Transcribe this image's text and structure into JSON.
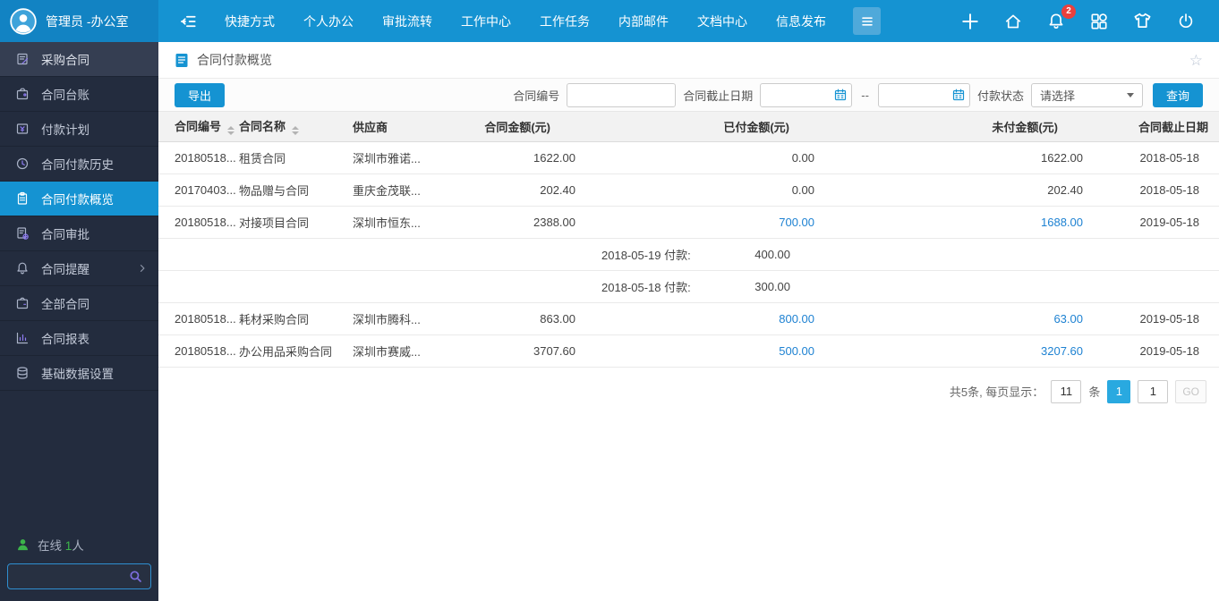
{
  "colors": {
    "topbar_blue": "#1593d2",
    "topbar_user_blue": "#1283c3",
    "sidebar_dark": "#232c3e",
    "active_item_blue": "#1593d2",
    "link_blue": "#1e82d2",
    "badge_red": "#e9403d",
    "online_green": "#3cb54a",
    "page_active_blue": "#29a9e0"
  },
  "topbar": {
    "user_name": "管理员 -办公室",
    "nav": [
      "快捷方式",
      "个人办公",
      "审批流转",
      "工作中心",
      "工作任务",
      "内部邮件",
      "文档中心",
      "信息发布"
    ],
    "notification_badge": "2",
    "right_icons": [
      "plus-icon",
      "home-icon",
      "bell-icon",
      "apps-icon",
      "theme-shirt-icon",
      "power-icon"
    ]
  },
  "sidebar": {
    "items": [
      {
        "label": "采购合同",
        "icon": "doc-edit-icon"
      },
      {
        "label": "合同台账",
        "icon": "wallet-icon"
      },
      {
        "label": "付款计划",
        "icon": "payment-plan-icon"
      },
      {
        "label": "合同付款历史",
        "icon": "clock-icon"
      },
      {
        "label": "合同付款概览",
        "icon": "clipboard-icon",
        "active": true
      },
      {
        "label": "合同审批",
        "icon": "approval-icon"
      },
      {
        "label": "合同提醒",
        "icon": "bell-icon",
        "has_submenu": true
      },
      {
        "label": "全部合同",
        "icon": "briefcase-icon"
      },
      {
        "label": "合同报表",
        "icon": "chart-icon"
      },
      {
        "label": "基础数据设置",
        "icon": "database-icon"
      }
    ],
    "online_label": "在线",
    "online_count": "1",
    "online_suffix": "人"
  },
  "page": {
    "title": "合同付款概览",
    "toolbar": {
      "export_label": "导出",
      "contract_no_label": "合同编号",
      "deadline_label": "合同截止日期",
      "range_separator": "--",
      "status_label": "付款状态",
      "status_placeholder": "请选择",
      "query_label": "查询"
    },
    "table": {
      "columns": [
        {
          "label": "合同编号",
          "sortable": true
        },
        {
          "label": "合同名称",
          "sortable": true
        },
        {
          "label": "供应商",
          "sortable": false
        },
        {
          "label": "合同金额(元)",
          "sortable": false
        },
        {
          "label": "已付金额(元)",
          "sortable": false
        },
        {
          "label": "未付金额(元)",
          "sortable": false
        },
        {
          "label": "合同截止日期",
          "sortable": false
        }
      ],
      "rows": [
        {
          "type": "data",
          "contract_no": "20180518...",
          "name": "租赁合同",
          "supplier": "深圳市雅诺...",
          "amount": "1622.00",
          "paid": "0.00",
          "paid_is_link": false,
          "unpaid": "1622.00",
          "unpaid_is_link": false,
          "deadline": "2018-05-18"
        },
        {
          "type": "data",
          "contract_no": "20170403...",
          "name": "物品赠与合同",
          "supplier": "重庆金茂联...",
          "amount": "202.40",
          "paid": "0.00",
          "paid_is_link": false,
          "unpaid": "202.40",
          "unpaid_is_link": false,
          "deadline": "2018-05-18"
        },
        {
          "type": "data",
          "contract_no": "20180518...",
          "name": "对接项目合同",
          "supplier": "深圳市恒东...",
          "amount": "2388.00",
          "paid": "700.00",
          "paid_is_link": true,
          "unpaid": "1688.00",
          "unpaid_is_link": true,
          "deadline": "2019-05-18"
        },
        {
          "type": "payment",
          "label": "2018-05-19 付款:",
          "value": "400.00"
        },
        {
          "type": "payment",
          "label": "2018-05-18 付款:",
          "value": "300.00"
        },
        {
          "type": "data",
          "contract_no": "20180518...",
          "name": "耗材采购合同",
          "supplier": "深圳市腾科...",
          "amount": "863.00",
          "paid": "800.00",
          "paid_is_link": true,
          "unpaid": "63.00",
          "unpaid_is_link": true,
          "deadline": "2019-05-18"
        },
        {
          "type": "data",
          "contract_no": "20180518...",
          "name": "办公用品采购合同",
          "supplier": "深圳市赛威...",
          "amount": "3707.60",
          "paid": "500.00",
          "paid_is_link": true,
          "unpaid": "3207.60",
          "unpaid_is_link": true,
          "deadline": "2019-05-18"
        }
      ]
    },
    "pagination": {
      "total_text": "共5条, 每页显示：",
      "page_size": "11",
      "unit_label": "条",
      "current_page": "1",
      "goto_value": "1",
      "go_label": "GO"
    }
  }
}
